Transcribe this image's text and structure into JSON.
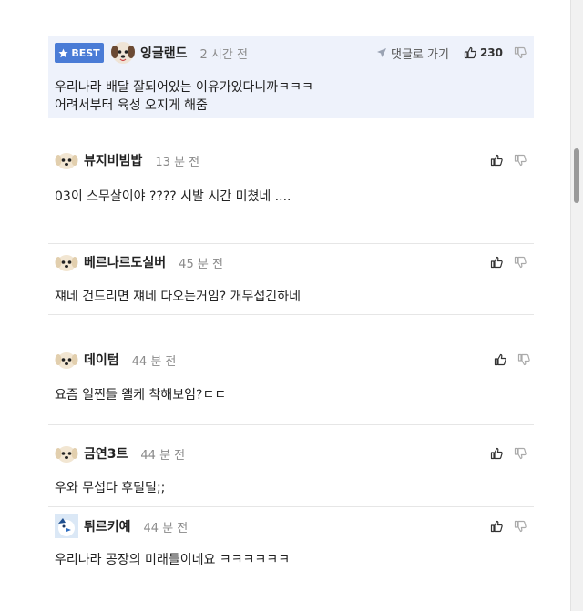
{
  "comments": [
    {
      "best": true,
      "badge": "BEST",
      "nick": "잉글랜드",
      "time": "2 시간 전",
      "reply_link": "댓글로 가기",
      "likes": "230",
      "lines": [
        "우리나라 배달 잘되어있는 이유가있다니까ㅋㅋㅋ",
        "어려서부터 육성 오지게 해줌"
      ]
    },
    {
      "nick": "뷰지비빔밥",
      "time": "13 분 전",
      "lines": [
        "03이 스무살이야 ???? 시발 시간 미쳤네 ...."
      ]
    },
    {
      "nick": "베르나르도실버",
      "time": "45 분 전",
      "lines": [
        "쟤네 건드리면 쟤네 다오는거임? 개무섭긴하네"
      ]
    },
    {
      "nick": "데이텀",
      "time": "44 분 전",
      "lines": [
        "요즘 일찐들 왤케 착해보임?ㄷㄷ"
      ]
    },
    {
      "nick": "금연3트",
      "time": "44 분 전",
      "lines": [
        "우와 무섭다 후덜덜;;"
      ]
    },
    {
      "nick": "튀르키예",
      "time": "44 분 전",
      "lines": [
        "우리나라 공장의 미래들이네요 ㅋㅋㅋㅋㅋㅋ"
      ]
    }
  ],
  "icons": {
    "best_star": "star-icon",
    "reply_arrow": "send-arrow-icon",
    "like": "thumbs-up-icon",
    "dislike": "thumbs-down-icon",
    "avatar_dog": "dog-avatar-icon",
    "avatar_bird": "bird-avatar-icon"
  },
  "colors": {
    "best_bg": "#eef2fb",
    "badge_bg": "#4a7cd6"
  }
}
